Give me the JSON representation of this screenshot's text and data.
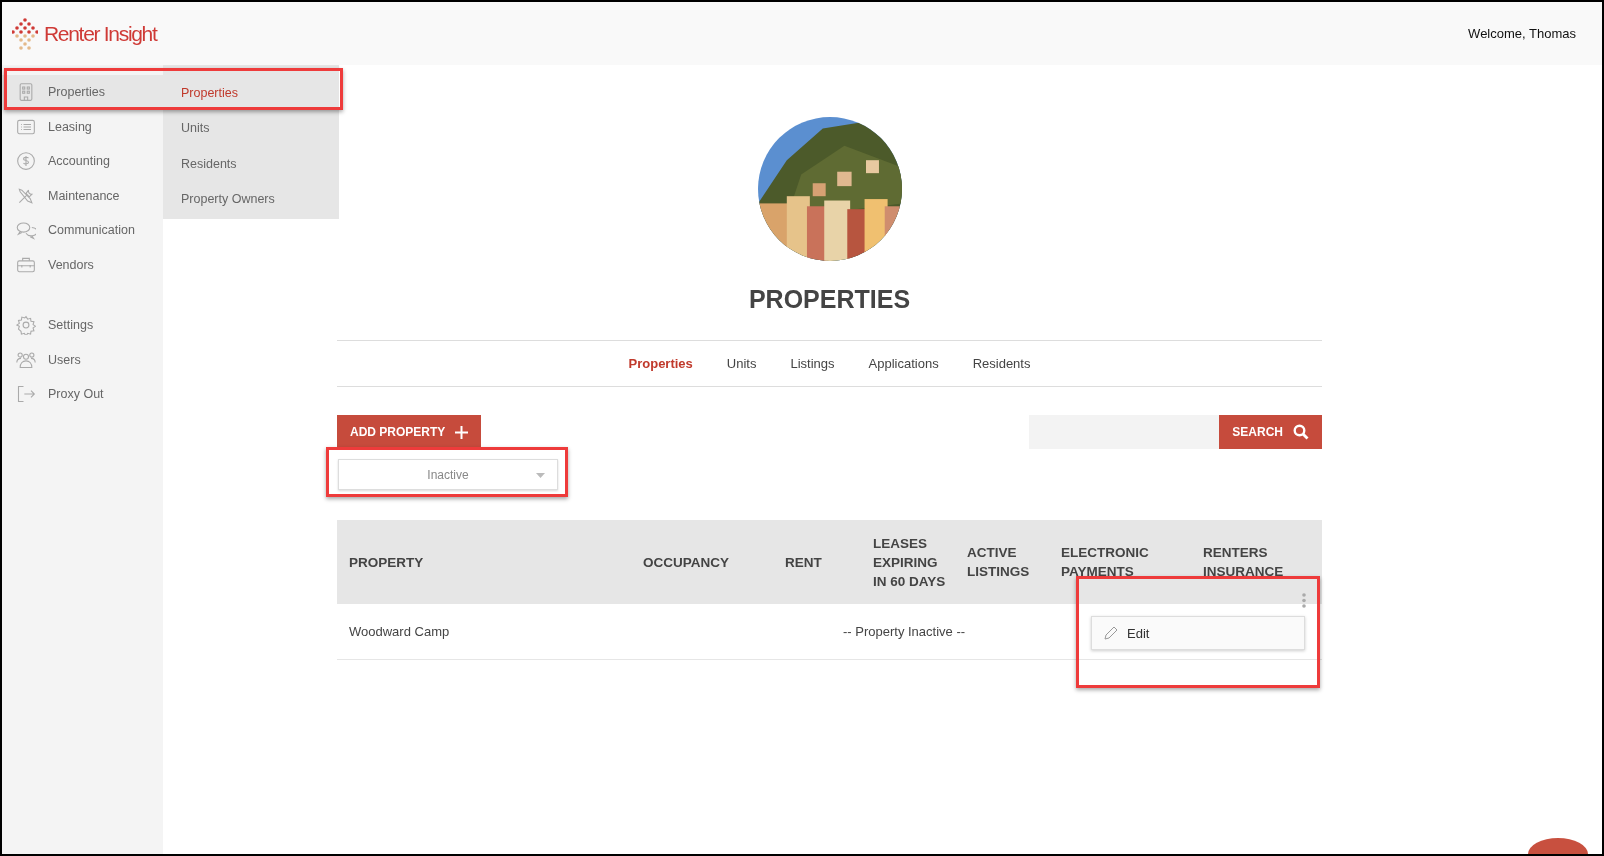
{
  "header": {
    "logo": "Renter Insight",
    "welcome": "Welcome, Thomas"
  },
  "sidebar": {
    "main_items": [
      {
        "label": "Properties",
        "kind": "building",
        "selected": true,
        "highlighted": true
      },
      {
        "label": "Leasing",
        "kind": "list",
        "selected": false,
        "highlighted": false
      },
      {
        "label": "Accounting",
        "kind": "dollar",
        "selected": false,
        "highlighted": false
      },
      {
        "label": "Maintenance",
        "kind": "tools",
        "selected": false,
        "highlighted": false
      },
      {
        "label": "Communication",
        "kind": "chat",
        "selected": false,
        "highlighted": false
      },
      {
        "label": "Vendors",
        "kind": "briefcase",
        "selected": false,
        "highlighted": false
      }
    ],
    "admin_items": [
      {
        "label": "Settings",
        "kind": "gear",
        "selected": false
      },
      {
        "label": "Users",
        "kind": "users",
        "selected": false
      },
      {
        "label": "Proxy Out",
        "kind": "exit",
        "selected": false
      }
    ]
  },
  "submenu": {
    "items": [
      {
        "label": "Properties",
        "selected": true
      },
      {
        "label": "Units",
        "selected": false
      },
      {
        "label": "Residents",
        "selected": false
      },
      {
        "label": "Property Owners",
        "selected": false
      }
    ]
  },
  "page": {
    "title": "PROPERTIES",
    "tabs": [
      {
        "label": "Properties",
        "selected": true
      },
      {
        "label": "Units",
        "selected": false
      },
      {
        "label": "Listings",
        "selected": false
      },
      {
        "label": "Applications",
        "selected": false
      },
      {
        "label": "Residents",
        "selected": false
      }
    ],
    "add_button": "ADD PROPERTY",
    "search": {
      "button": "SEARCH"
    },
    "status_filter": {
      "value": "Inactive",
      "highlighted": true
    },
    "table": {
      "columns": [
        "PROPERTY",
        "OCCUPANCY",
        "RENT",
        "LEASES EXPIRING IN 60 DAYS",
        "ACTIVE LISTINGS",
        "ELECTRONIC PAYMENTS",
        "RENTERS INSURANCE"
      ],
      "rows": [
        {
          "property": "Woodward Camp",
          "status": "-- Property Inactive --"
        }
      ]
    },
    "row_menu": {
      "items": [
        {
          "label": "Edit",
          "kind": "pencil"
        }
      ],
      "highlighted": true
    }
  }
}
